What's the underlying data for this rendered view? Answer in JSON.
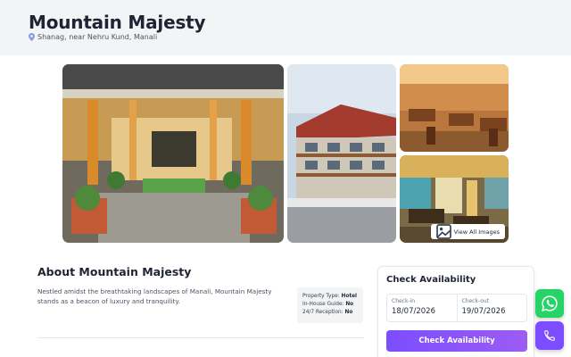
{
  "property": {
    "name": "Mountain Majesty",
    "location": "Shanag, near Nehru Kund, Manali"
  },
  "gallery": {
    "view_all_label": "View All Images",
    "photos": [
      {
        "name": "entrance-photo"
      },
      {
        "name": "building-photo"
      },
      {
        "name": "restaurant-photo"
      },
      {
        "name": "dining-hall-photo"
      }
    ]
  },
  "about": {
    "title": "About Mountain Majesty",
    "description": "Nestled amidst the breathtaking landscapes of Manali, Mountain Majesty stands as a beacon of luxury and tranquility.",
    "facts": [
      {
        "label": "Property Type:",
        "value": "Hotel"
      },
      {
        "label": "In-House Guide:",
        "value": "No"
      },
      {
        "label": "24/7 Reception:",
        "value": "No"
      }
    ]
  },
  "availability": {
    "title": "Check Availability",
    "check_in_label": "Check-in",
    "check_in_value": "18/07/2026",
    "check_out_label": "Check-out",
    "check_out_value": "19/07/2026",
    "button_label": "Check Availability"
  },
  "icons": {
    "location": "map-pin-icon",
    "gallery": "images-icon",
    "whatsapp": "whatsapp-icon",
    "phone": "phone-icon"
  },
  "colors": {
    "accent": "#7c4dff",
    "whatsapp": "#25d366",
    "title": "#1e2433"
  }
}
